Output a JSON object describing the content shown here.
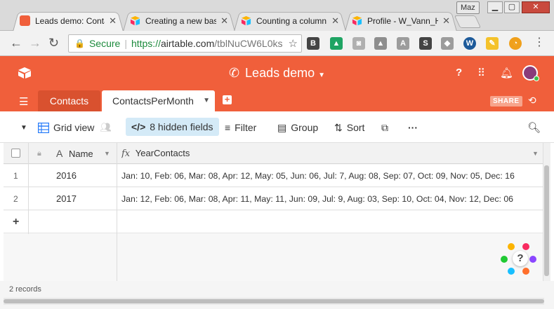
{
  "browser": {
    "tabs": [
      {
        "title": "Leads demo: Contac",
        "active": true
      },
      {
        "title": "Creating a new basi",
        "active": false
      },
      {
        "title": "Counting a column",
        "active": false
      },
      {
        "title": "Profile - W_Vann_H",
        "active": false
      }
    ],
    "profile_name": "Maz",
    "address": {
      "secure_label": "Secure",
      "scheme": "https://",
      "host": "airtable.com",
      "path": "/tblNuCW6L0ks"
    }
  },
  "app": {
    "base_title": "Leads demo",
    "brand_color": "#f05f3b",
    "tables": [
      {
        "label": "Contacts",
        "active": false
      },
      {
        "label": "ContactsPerMonth",
        "active": true
      }
    ],
    "share_label": "SHARE"
  },
  "viewbar": {
    "view_name": "Grid view",
    "hidden_fields": "8 hidden fields",
    "filter": "Filter",
    "group": "Group",
    "sort": "Sort",
    "more": "···"
  },
  "grid": {
    "columns": [
      {
        "name": "Name",
        "type_icon": "A"
      },
      {
        "name": "YearContacts",
        "type_icon": "fx"
      }
    ],
    "rows": [
      {
        "num": "1",
        "name": "2016",
        "value": "Jan: 10, Feb: 06, Mar: 08, Apr: 12, May: 05, Jun: 06, Jul: 7, Aug: 08, Sep: 07, Oct: 09, Nov: 05, Dec: 16"
      },
      {
        "num": "2",
        "name": "2017",
        "value": "Jan: 12, Feb: 06, Mar: 08, Apr: 11, May: 11, Jun: 09, Jul: 9, Aug: 03, Sep: 10, Oct: 04, Nov: 12, Dec: 06"
      }
    ],
    "add_row": "+",
    "record_count": "2 records"
  }
}
